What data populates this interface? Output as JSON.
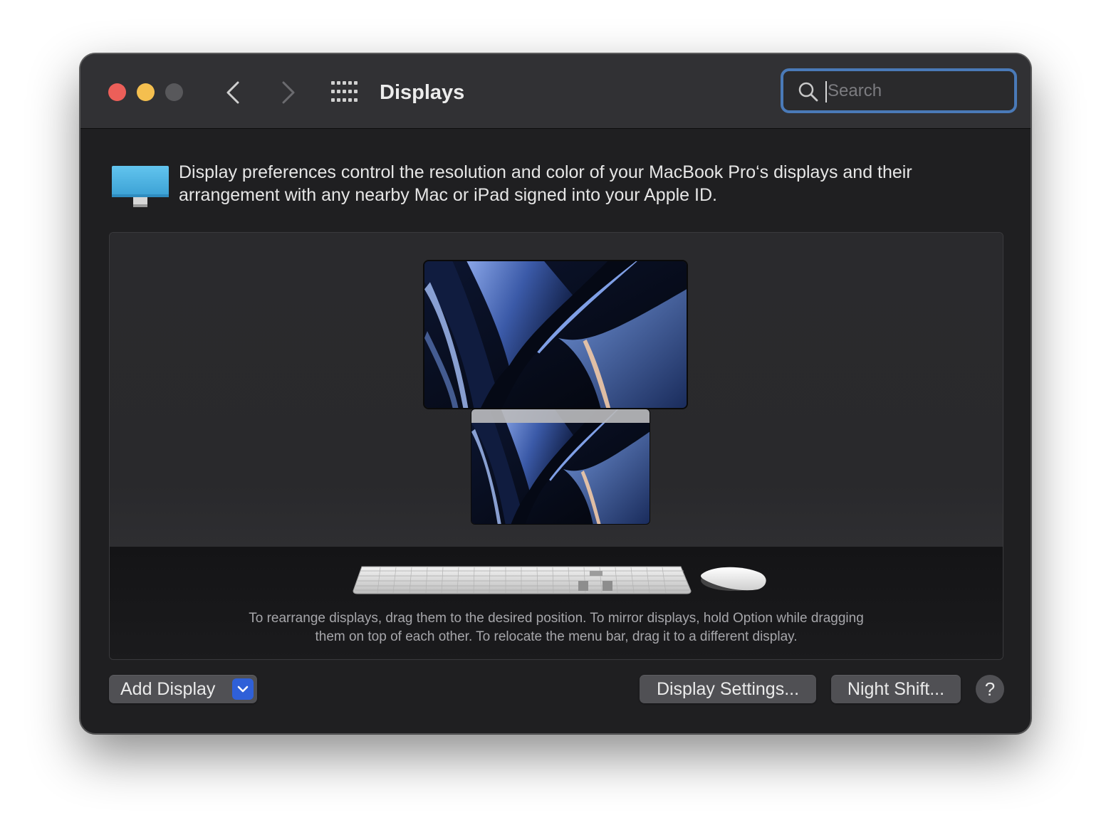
{
  "window": {
    "title": "Displays"
  },
  "search": {
    "placeholder": "Search",
    "value": ""
  },
  "intro": {
    "text": "Display preferences control the resolution and color of your MacBook Pro‘s displays and their arrangement with any nearby Mac or iPad signed into your Apple ID."
  },
  "arrangement": {
    "hint_line1": "To rearrange displays, drag them to the desired position. To mirror displays, hold Option while dragging",
    "hint_line2": "them on top of each other. To relocate the menu bar, drag it to a different display."
  },
  "buttons": {
    "add_display": "Add Display",
    "display_settings": "Display Settings...",
    "night_shift": "Night Shift...",
    "help": "?"
  },
  "icons": {
    "close": "close-icon",
    "minimize": "minimize-icon",
    "zoom": "zoom-icon",
    "back": "chevron-left-icon",
    "forward": "chevron-right-icon",
    "show_all": "grid-icon",
    "search": "magnifier-icon",
    "intro": "display-icon",
    "dropdown": "chevron-down-icon"
  },
  "colors": {
    "accent": "#2f60d8",
    "search_focus": "#4a7ab8",
    "close": "#ec5f59",
    "minimize": "#f4bf4f",
    "zoom_disabled": "#58585b",
    "window_bg": "#1f1f21",
    "titlebar_bg": "#313134"
  }
}
